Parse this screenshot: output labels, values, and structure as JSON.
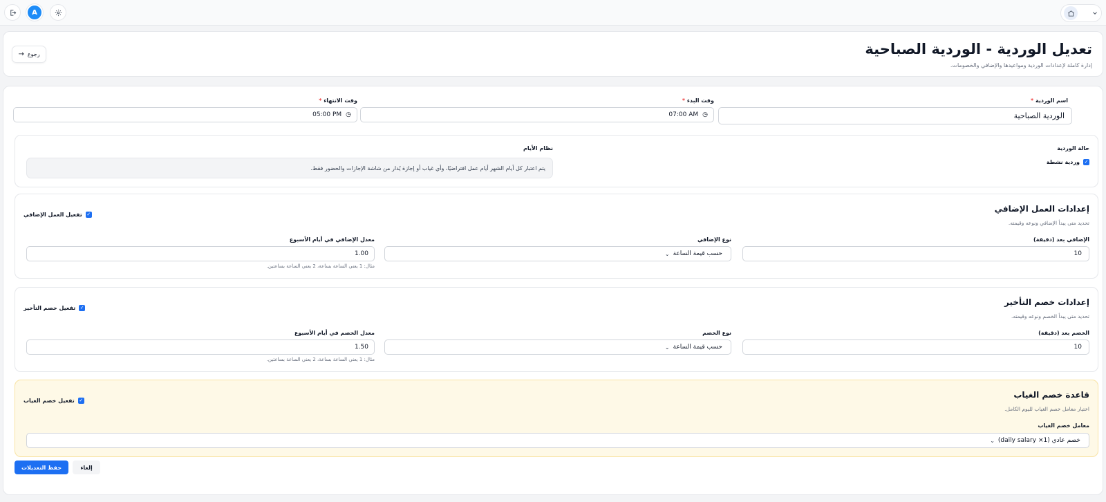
{
  "topbar": {
    "avatar_letter": "A",
    "icons": [
      "logout-icon",
      "gear-icon",
      "home-icon",
      "chevron-down-icon"
    ]
  },
  "header": {
    "title": "تعديل الوردية - الوردية الصباحية",
    "subtitle": "إدارة كاملة لإعدادات الوردية ومواعيدها والإضافي والخصومات.",
    "back_label": "رجوع"
  },
  "shift": {
    "name_label": "اسم الوردية",
    "name_value": "الوردية الصباحية",
    "start_label": "وقت البدء",
    "start_value": "07:00 AM",
    "end_label": "وقت الانتهاء",
    "end_value": "05:00 PM",
    "required_mark": "*"
  },
  "status": {
    "status_label": "حالة الوردية",
    "active_label": "وردية نشطة",
    "days_label": "نظام الأيام",
    "days_info": "يتم اعتبار كل أيام الشهر أيام عمل افتراضيًا، وأي غياب أو إجازة يُدار من شاشة الإجازات والحضور فقط."
  },
  "overtime": {
    "title": "إعدادات العمل الإضافي",
    "subtitle": "تحديد متى يبدأ الإضافي ونوعه وقيمته.",
    "toggle_label": "تفعيل العمل الإضافي",
    "after_label": "الإضافي بعد (دقيقة)",
    "after_value": "10",
    "type_label": "نوع الإضافي",
    "type_value": "حسب قيمة الساعة",
    "rate_label": "معدل الإضافي في أيام الأسبوع",
    "rate_value": "1.00",
    "rate_hint": "مثال: 1 يعني الساعة بساعة، 2 يعني الساعة بساعتين."
  },
  "late": {
    "title": "إعدادات خصم التأخير",
    "subtitle": "تحديد متى يبدأ الخصم ونوعه وقيمته.",
    "toggle_label": "تفعيل خصم التأخير",
    "after_label": "الخصم بعد (دقيقة)",
    "after_value": "10",
    "type_label": "نوع الخصم",
    "type_value": "حسب قيمة الساعة",
    "rate_label": "معدل الخصم في أيام الأسبوع",
    "rate_value": "1.50",
    "rate_hint": "مثال: 1 يعني الساعة بساعة، 2 يعني الساعة بساعتين."
  },
  "absence": {
    "title": "قاعدة خصم الغياب",
    "subtitle": "اختيار معامل خصم الغياب لليوم الكامل.",
    "toggle_label": "تفعيل خصم الغياب",
    "factor_label": "معامل خصم الغياب",
    "factor_value": "خصم عادي (1× daily salary)"
  },
  "actions": {
    "save_label": "حفظ التعديلات",
    "cancel_label": "إلغاء"
  },
  "colors": {
    "primary": "#1d6ff2",
    "absence_bg": "#fef9e7",
    "absence_border": "#f8e3a3"
  }
}
